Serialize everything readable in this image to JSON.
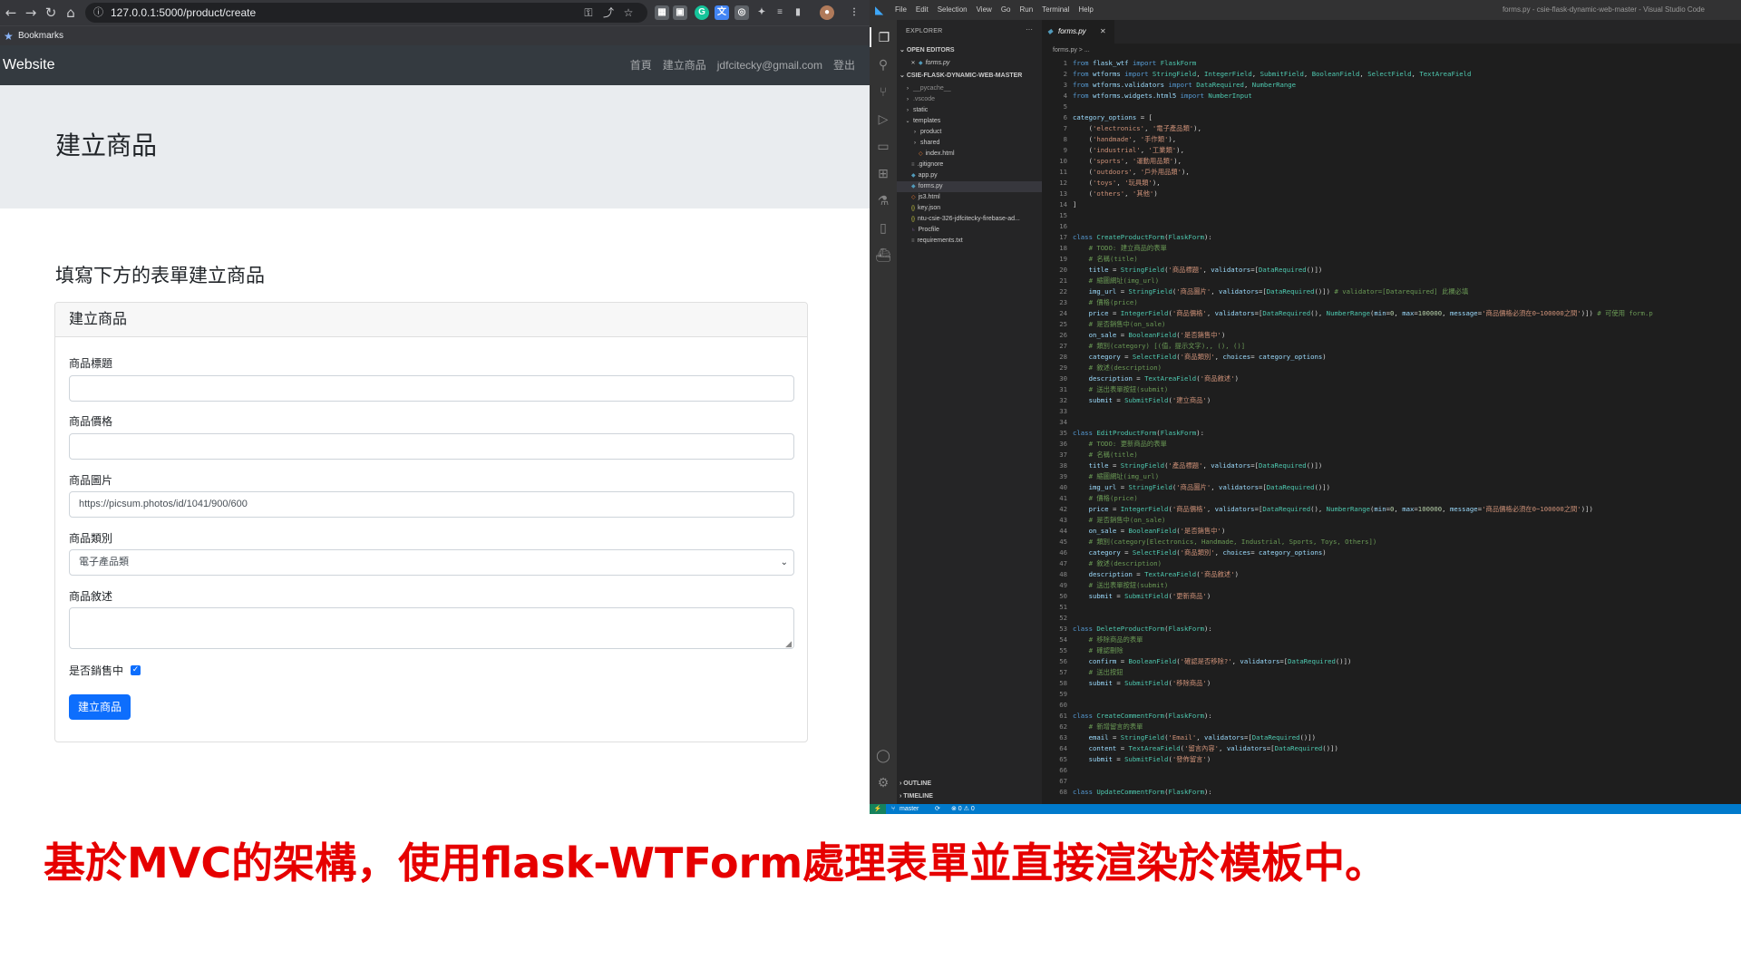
{
  "browser": {
    "url": "127.0.0.1:5000/product/create",
    "bookmarks_label": "Bookmarks",
    "nav": {
      "back_icon": "←",
      "forward_icon": "→",
      "reload_icon": "↻",
      "home_icon": "⌂"
    },
    "ext_icons": [
      "⚿",
      "⤴",
      "☆"
    ]
  },
  "site": {
    "brand": "Website",
    "nav_links": [
      "首頁",
      "建立商品",
      "jdfcitecky@gmail.com",
      "登出"
    ],
    "page_title": "建立商品",
    "lead": "填寫下方的表單建立商品",
    "card_title": "建立商品",
    "form": {
      "title_label": "商品標題",
      "title_value": "",
      "price_label": "商品價格",
      "price_value": "",
      "img_label": "商品圖片",
      "img_value": "https://picsum.photos/id/1041/900/600",
      "category_label": "商品類別",
      "category_value": "電子產品類",
      "description_label": "商品敘述",
      "description_value": "",
      "on_sale_label": "是否銷售中",
      "on_sale_checked": true,
      "submit_label": "建立商品"
    }
  },
  "vscode": {
    "menu": [
      "File",
      "Edit",
      "Selection",
      "View",
      "Go",
      "Run",
      "Terminal",
      "Help"
    ],
    "window_title": "forms.py - csie-flask-dynamic-web-master - Visual Studio Code",
    "explorer_title": "EXPLORER",
    "explorer_more": "···",
    "open_editors_label": "OPEN EDITORS",
    "open_editor_file": "forms.py",
    "project_label": "CSIE-FLASK-DYNAMIC-WEB-MASTER",
    "files": [
      {
        "name": "__pycache__",
        "kind": "folder"
      },
      {
        "name": ".vscode",
        "kind": "folder"
      },
      {
        "name": "static",
        "kind": "folder"
      },
      {
        "name": "templates",
        "kind": "folder-open"
      },
      {
        "name": "product",
        "kind": "sub-folder"
      },
      {
        "name": "shared",
        "kind": "sub-folder"
      },
      {
        "name": "index.html",
        "kind": "sub-html"
      },
      {
        "name": ".gitignore",
        "kind": "file"
      },
      {
        "name": "app.py",
        "kind": "py"
      },
      {
        "name": "forms.py",
        "kind": "py-selected"
      },
      {
        "name": "js3.html",
        "kind": "html"
      },
      {
        "name": "key.json",
        "kind": "json"
      },
      {
        "name": "ntu-csie-326-jdfcitecky-firebase-ad...",
        "kind": "json"
      },
      {
        "name": "Procfile",
        "kind": "proc"
      },
      {
        "name": "requirements.txt",
        "kind": "file"
      }
    ],
    "outline_label": "OUTLINE",
    "timeline_label": "TIMELINE",
    "tab_label": "forms.py",
    "breadcrumb": "forms.py > ...",
    "status_branch": "master",
    "status_problems": "⊗ 0 ⚠ 0",
    "code_lines": [
      "from flask_wtf import FlaskForm",
      "from wtforms import StringField, IntegerField, SubmitField, BooleanField, SelectField, TextAreaField",
      "from wtforms.validators import DataRequired, NumberRange",
      "from wtforms.widgets.html5 import NumberInput",
      "",
      "category_options = [",
      "    ('electronics', '電子產品類'),",
      "    ('handmade', '手作類'),",
      "    ('industrial', '工業類'),",
      "    ('sports', '運動用品類'),",
      "    ('outdoors', '戶外用品類'),",
      "    ('toys', '玩具類'),",
      "    ('others', '其他')",
      "]",
      "",
      "",
      "class CreateProductForm(FlaskForm):",
      "    # TODO: 建立商品的表單",
      "    # 名稱(title)",
      "    title = StringField('商品標題', validators=[DataRequired()])",
      "    # 縮圖網址(img_url)",
      "    img_url = StringField('商品圖片', validators=[DataRequired()]) # validator=[Datarequired] 此欄必填",
      "    # 價格(price)",
      "    price = IntegerField('商品價格', validators=[DataRequired(), NumberRange(min=0, max=100000, message='商品價格必須在0~100000之間')]) # 可使用 form.p",
      "    # 是否銷售中(on_sale)",
      "    on_sale = BooleanField('是否銷售中')",
      "    # 類別(category) [(值，提示文字),, (), ()]",
      "    category = SelectField('商品類別', choices= category_options)",
      "    # 敘述(description)",
      "    description = TextAreaField('商品敘述')",
      "    # 送出表單按鈕(submit)",
      "    submit = SubmitField('建立商品')",
      "",
      "",
      "class EditProductForm(FlaskForm):",
      "    # TODO: 更新商品的表單",
      "    # 名稱(title)",
      "    title = StringField('產品標題', validators=[DataRequired()])",
      "    # 縮圖網址(img_url)",
      "    img_url = StringField('商品圖片', validators=[DataRequired()])",
      "    # 價格(price)",
      "    price = IntegerField('商品價格', validators=[DataRequired(), NumberRange(min=0, max=100000, message='商品價格必須在0~100000之間')])",
      "    # 是否銷售中(on_sale)",
      "    on_sale = BooleanField('是否銷售中')",
      "    # 類別(category[Electronics, Handmade, Industrial, Sports, Toys, Others])",
      "    category = SelectField('商品類別', choices= category_options)",
      "    # 敘述(description)",
      "    description = TextAreaField('商品敘述')",
      "    # 送出表單按鈕(submit)",
      "    submit = SubmitField('更新商品')",
      "",
      "",
      "class DeleteProductForm(FlaskForm):",
      "    # 移除商品的表單",
      "    # 確認刪除",
      "    confirm = BooleanField('確認是否移除?', validators=[DataRequired()])",
      "    # 送出按鈕",
      "    submit = SubmitField('移除商品')",
      "",
      "",
      "class CreateCommentForm(FlaskForm):",
      "    # 新增留言的表單",
      "    email = StringField('Email', validators=[DataRequired()])",
      "    content = TextAreaField('留言內容', validators=[DataRequired()])",
      "    submit = SubmitField('發佈留言')",
      "",
      "",
      "class UpdateCommentForm(FlaskForm):"
    ]
  },
  "caption": "基於MVC的架構，使用flask-WTForm處理表單並直接渲染於模板中。",
  "colors": {
    "navbar": "#343a40",
    "jumbotron": "#e9ecef",
    "primary": "#0d6efd",
    "vscode_bg": "#1e1e1e",
    "vscode_status": "#007acc",
    "caption": "#e60000",
    "keyword": "#569cd6",
    "string": "#ce9178",
    "comment": "#6a9955",
    "class": "#4ec9b0",
    "function": "#dcdcaa",
    "variable": "#9cdcfe"
  }
}
